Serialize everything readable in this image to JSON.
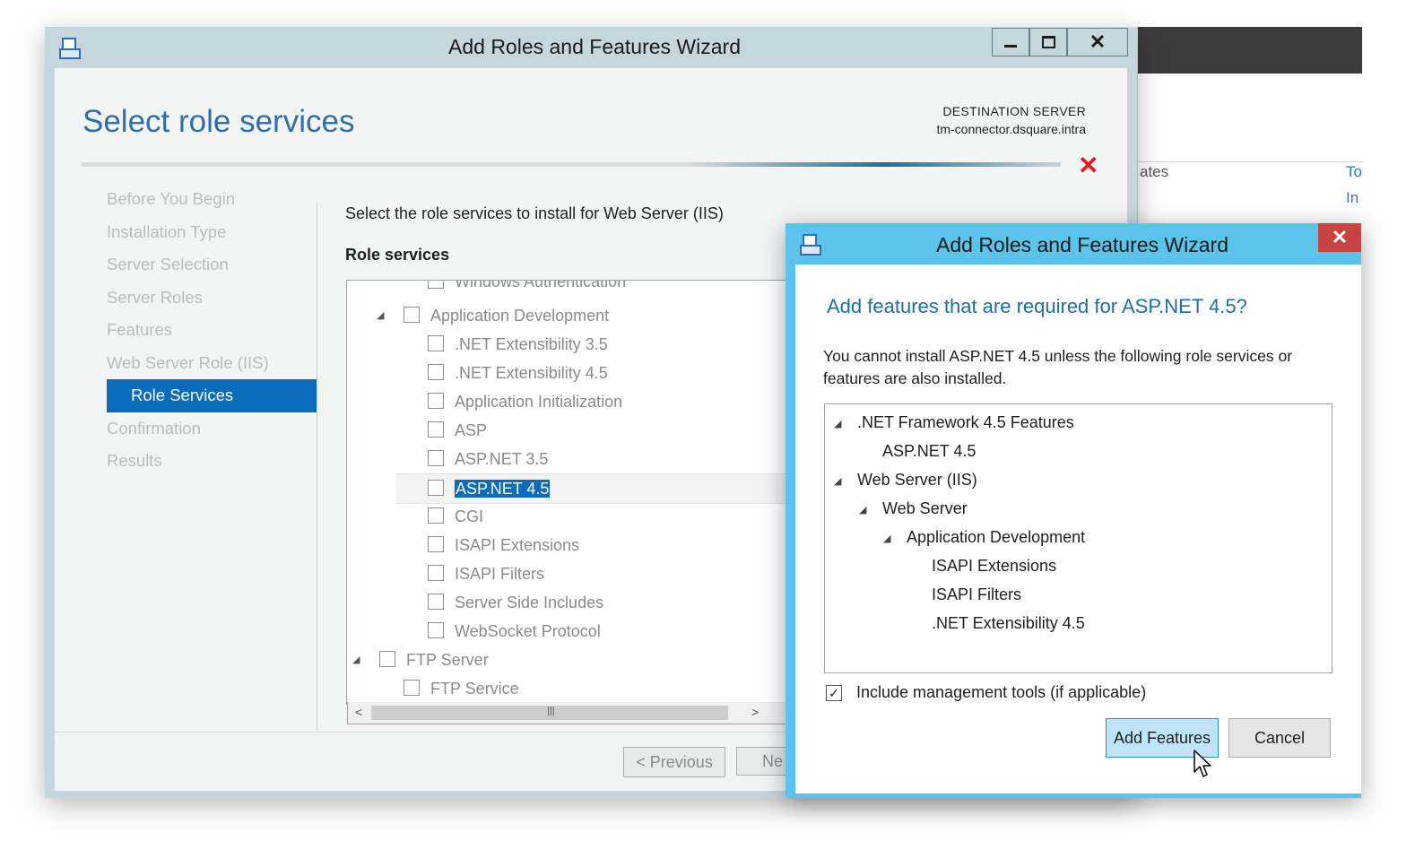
{
  "main_window": {
    "title": "Add Roles and Features Wizard",
    "page_title": "Select role services",
    "destination_label": "DESTINATION SERVER",
    "destination_server": "tm-connector.dsquare.intra",
    "nav": [
      {
        "label": "Before You Begin",
        "active": false
      },
      {
        "label": "Installation Type",
        "active": false
      },
      {
        "label": "Server Selection",
        "active": false
      },
      {
        "label": "Server Roles",
        "active": false
      },
      {
        "label": "Features",
        "active": false
      },
      {
        "label": "Web Server Role (IIS)",
        "active": false
      },
      {
        "label": "Role Services",
        "active": true
      },
      {
        "label": "Confirmation",
        "active": false
      },
      {
        "label": "Results",
        "active": false
      }
    ],
    "instruction": "Select the role services to install for Web Server (IIS)",
    "role_services_label": "Role services",
    "tree_items": [
      {
        "label": "Windows Authentication",
        "checked": false
      },
      {
        "label": "Application Development",
        "checked": false,
        "expanded": true
      },
      {
        "label": ".NET Extensibility 3.5",
        "checked": false
      },
      {
        "label": ".NET Extensibility 4.5",
        "checked": false
      },
      {
        "label": "Application Initialization",
        "checked": false
      },
      {
        "label": "ASP",
        "checked": false
      },
      {
        "label": "ASP.NET 3.5",
        "checked": false
      },
      {
        "label": "ASP.NET 4.5",
        "checked": false,
        "selected": true
      },
      {
        "label": "CGI",
        "checked": false
      },
      {
        "label": "ISAPI Extensions",
        "checked": false
      },
      {
        "label": "ISAPI Filters",
        "checked": false
      },
      {
        "label": "Server Side Includes",
        "checked": false
      },
      {
        "label": "WebSocket Protocol",
        "checked": false
      },
      {
        "label": "FTP Server",
        "checked": false,
        "expanded": true
      },
      {
        "label": "FTP Service",
        "checked": false
      }
    ],
    "buttons": {
      "previous": "< Previous",
      "next": "Ne"
    }
  },
  "background_window": {
    "text_1": "ates",
    "link_1": "To",
    "link_2": "In"
  },
  "dialog": {
    "title": "Add Roles and Features Wizard",
    "heading": "Add features that are required for ASP.NET 4.5?",
    "description": "You cannot install ASP.NET 4.5 unless the following role services or features are also installed.",
    "features": [
      {
        "label": ".NET Framework 4.5 Features",
        "expander": true
      },
      {
        "label": "ASP.NET 4.5",
        "expander": false
      },
      {
        "label": "Web Server (IIS)",
        "expander": true
      },
      {
        "label": "Web Server",
        "expander": true
      },
      {
        "label": "Application Development",
        "expander": true
      },
      {
        "label": "ISAPI Extensions",
        "expander": false
      },
      {
        "label": "ISAPI Filters",
        "expander": false
      },
      {
        "label": ".NET Extensibility 4.5",
        "expander": false
      }
    ],
    "include_tools_label": "Include management tools (if applicable)",
    "include_tools_checked": true,
    "add_button": "Add Features",
    "cancel_button": "Cancel"
  },
  "colors": {
    "accent": "#0b6bbd",
    "title_blue": "#2f6ea8",
    "dialog_frame": "#5bc4ea",
    "close_red": "#c74442",
    "error_red": "#e11b1b"
  }
}
